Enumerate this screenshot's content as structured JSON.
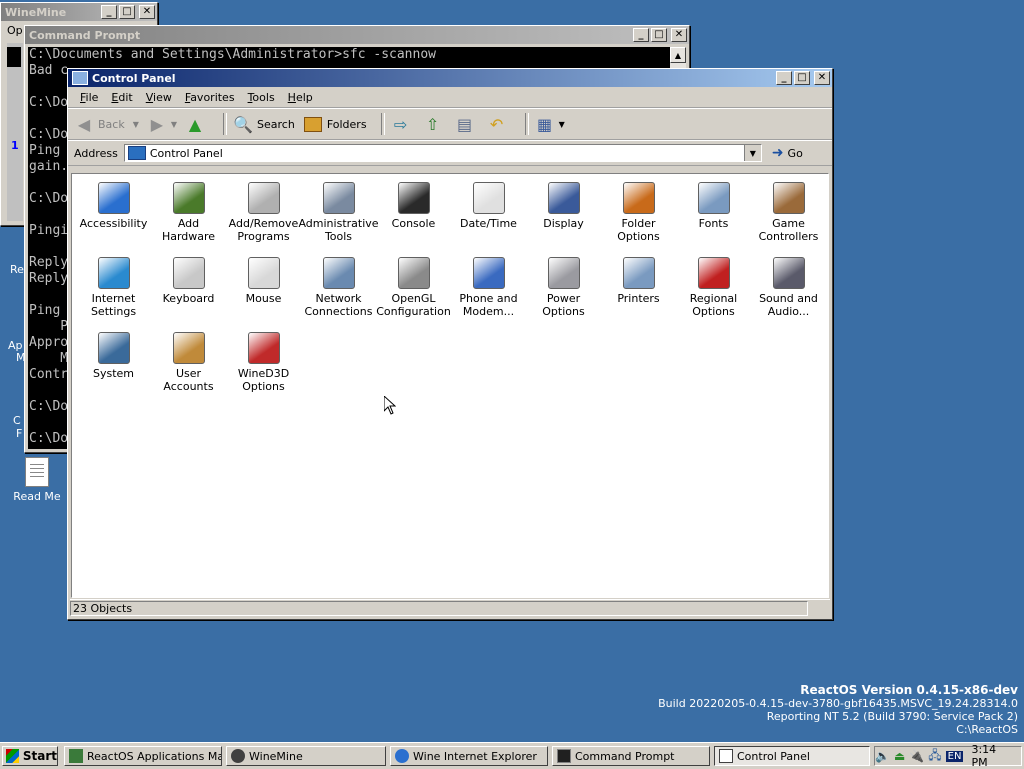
{
  "desktop": {
    "icons": [
      {
        "label": "Read Me"
      }
    ],
    "partial_labels": [
      "Re",
      "Ap",
      "M",
      "C",
      "F"
    ]
  },
  "version": {
    "line1": "ReactOS Version 0.4.15-x86-dev",
    "line2": "Build 20220205-0.4.15-dev-3780-gbf16435.MSVC_19.24.28314.0",
    "line3": "Reporting NT 5.2 (Build 3790: Service Pack 2)",
    "line4": "C:\\ReactOS"
  },
  "winemine": {
    "title": "WineMine",
    "menu_partial": "Op",
    "counter_partial": "1"
  },
  "cmd": {
    "title": "Command Prompt",
    "lines": [
      "C:\\Documents and Settings\\Administrator>sfc -scannow",
      "Bad c",
      "",
      "C:\\Do",
      "",
      "C:\\Do",
      "Ping",
      "gain.",
      "",
      "C:\\Do",
      "",
      "Pingi",
      "",
      "Reply",
      "Reply",
      "",
      "Ping",
      "    P",
      "Appro",
      "    M",
      "Contr",
      "",
      "C:\\Do",
      "",
      "C:\\Do"
    ]
  },
  "control_panel": {
    "title": "Control Panel",
    "menu": [
      {
        "label": "File",
        "ul": "F",
        "rest": "ile"
      },
      {
        "label": "Edit",
        "ul": "E",
        "rest": "dit"
      },
      {
        "label": "View",
        "ul": "V",
        "rest": "iew"
      },
      {
        "label": "Favorites",
        "ul": "F",
        "rest": "avorites"
      },
      {
        "label": "Tools",
        "ul": "T",
        "rest": "ools"
      },
      {
        "label": "Help",
        "ul": "H",
        "rest": "elp"
      }
    ],
    "toolbar": {
      "back": "Back",
      "search": "Search",
      "folders": "Folders"
    },
    "address": {
      "label": "Address",
      "value": "Control Panel",
      "go": "Go"
    },
    "items": [
      {
        "name": "Accessibility",
        "line2": "",
        "color": "#2a6fcf",
        "icon": "accessibility-icon"
      },
      {
        "name": "Add",
        "line2": "Hardware",
        "color": "#4a7a2a",
        "icon": "add-hardware-icon"
      },
      {
        "name": "Add/Remove",
        "line2": "Programs",
        "color": "#b0b0b0",
        "icon": "add-remove-programs-icon"
      },
      {
        "name": "Administrative",
        "line2": "Tools",
        "color": "#7a8aa0",
        "icon": "administrative-tools-icon"
      },
      {
        "name": "Console",
        "line2": "",
        "color": "#2a2a2a",
        "icon": "console-icon"
      },
      {
        "name": "Date/Time",
        "line2": "",
        "color": "#e0e0e0",
        "icon": "date-time-icon"
      },
      {
        "name": "Display",
        "line2": "",
        "color": "#3a5a9a",
        "icon": "display-icon"
      },
      {
        "name": "Folder",
        "line2": "Options",
        "color": "#c86a1a",
        "icon": "folder-options-icon"
      },
      {
        "name": "Fonts",
        "line2": "",
        "color": "#7a9ac0",
        "icon": "fonts-icon"
      },
      {
        "name": "Game",
        "line2": "Controllers",
        "color": "#9a6a3a",
        "icon": "game-controllers-icon"
      },
      {
        "name": "Internet",
        "line2": "Settings",
        "color": "#2a8acf",
        "icon": "internet-settings-icon"
      },
      {
        "name": "Keyboard",
        "line2": "",
        "color": "#c8c8c8",
        "icon": "keyboard-icon"
      },
      {
        "name": "Mouse",
        "line2": "",
        "color": "#d8d8d8",
        "icon": "mouse-icon"
      },
      {
        "name": "Network",
        "line2": "Connections",
        "color": "#6a8ab0",
        "icon": "network-connections-icon"
      },
      {
        "name": "OpenGL",
        "line2": "Configuration",
        "color": "#8a8a8a",
        "icon": "opengl-icon"
      },
      {
        "name": "Phone and",
        "line2": "Modem...",
        "color": "#3a6ac0",
        "icon": "phone-modem-icon"
      },
      {
        "name": "Power",
        "line2": "Options",
        "color": "#9a9aa0",
        "icon": "power-options-icon"
      },
      {
        "name": "Printers",
        "line2": "",
        "color": "#7a9ac0",
        "icon": "printers-icon"
      },
      {
        "name": "Regional",
        "line2": "Options",
        "color": "#c02020",
        "icon": "regional-options-icon"
      },
      {
        "name": "Sound and",
        "line2": "Audio...",
        "color": "#5a5a6a",
        "icon": "sound-audio-icon"
      },
      {
        "name": "System",
        "line2": "",
        "color": "#3a6a9a",
        "icon": "system-icon"
      },
      {
        "name": "User",
        "line2": "Accounts",
        "color": "#c08a3a",
        "icon": "user-accounts-icon"
      },
      {
        "name": "WineD3D",
        "line2": "Options",
        "color": "#c02a2a",
        "icon": "wined3d-icon"
      }
    ],
    "status": "23 Objects"
  },
  "taskbar": {
    "start": "Start",
    "tasks": [
      {
        "label": "ReactOS Applications Man...",
        "icon": "app-manager-icon",
        "color": "#3a7a3a"
      },
      {
        "label": "WineMine",
        "icon": "winemine-icon",
        "color": "#404040"
      },
      {
        "label": "Wine Internet Explorer",
        "icon": "internet-explorer-icon",
        "color": "#2a6fcf"
      },
      {
        "label": "Command Prompt",
        "icon": "command-prompt-icon",
        "color": "#202020"
      },
      {
        "label": "Control Panel",
        "icon": "control-panel-icon",
        "color": "#3a6ac0"
      }
    ],
    "tray": {
      "lang": "EN",
      "clock": "3:14 PM"
    }
  }
}
